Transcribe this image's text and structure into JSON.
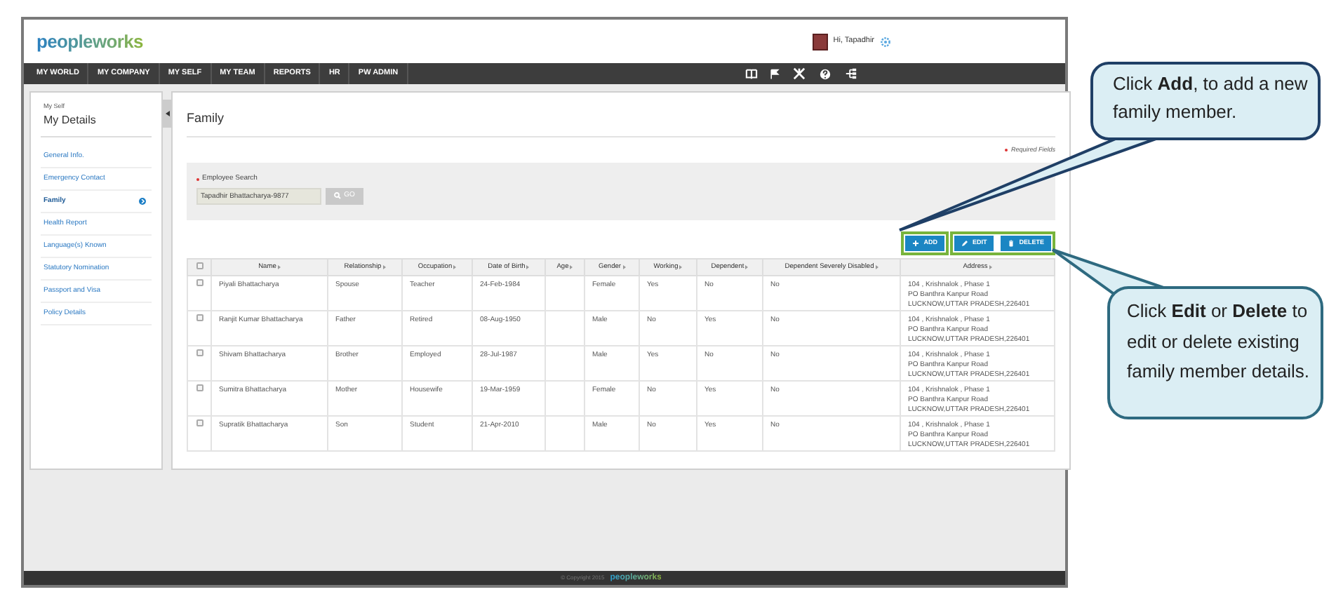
{
  "header": {
    "logo": "peopleworks",
    "greeting": "Hi, Tapadhir"
  },
  "nav": {
    "items": [
      "MY WORLD",
      "MY COMPANY",
      "MY SELF",
      "MY TEAM",
      "REPORTS",
      "HR",
      "PW ADMIN"
    ]
  },
  "sidebar": {
    "section": "My Self",
    "title": "My Details",
    "items": [
      {
        "label": "General Info.",
        "selected": false
      },
      {
        "label": "Emergency Contact",
        "selected": false
      },
      {
        "label": "Family",
        "selected": true
      },
      {
        "label": "Health Report",
        "selected": false
      },
      {
        "label": "Language(s) Known",
        "selected": false
      },
      {
        "label": "Statutory Nomination",
        "selected": false
      },
      {
        "label": "Passport and Visa",
        "selected": false
      },
      {
        "label": "Policy Details",
        "selected": false
      }
    ]
  },
  "main": {
    "title": "Family",
    "required_note": "Required Fields",
    "search": {
      "label": "Employee Search",
      "value": "Tapadhir Bhattacharya-9877",
      "button": "GO"
    },
    "actions": [
      {
        "kind": "add",
        "label": "ADD"
      },
      {
        "kind": "edit",
        "label": "EDIT"
      },
      {
        "kind": "delete",
        "label": "DELETE"
      }
    ],
    "table": {
      "header_checked": false,
      "columns": [
        "Name",
        "Relationship",
        "Occupation",
        "Date of Birth",
        "Age",
        "Gender",
        "Working",
        "Dependent",
        "Dependent Severely Disabled",
        "Address"
      ],
      "rows": [
        {
          "checked": false,
          "cells": [
            "Piyali Bhattacharya",
            "Spouse",
            "Teacher",
            "24-Feb-1984",
            "",
            "Female",
            "Yes",
            "No",
            "No",
            "104 , Krishnalok , Phase 1\nPO Banthra Kanpur Road\nLUCKNOW,UTTAR PRADESH,226401"
          ]
        },
        {
          "checked": false,
          "cells": [
            "Ranjit Kumar Bhattacharya",
            "Father",
            "Retired",
            "08-Aug-1950",
            "",
            "Male",
            "No",
            "Yes",
            "No",
            "104 , Krishnalok , Phase 1\nPO Banthra Kanpur Road\nLUCKNOW,UTTAR PRADESH,226401"
          ]
        },
        {
          "checked": false,
          "cells": [
            "Shivam Bhattacharya",
            "Brother",
            "Employed",
            "28-Jul-1987",
            "",
            "Male",
            "Yes",
            "No",
            "No",
            "104 , Krishnalok , Phase 1\nPO Banthra Kanpur Road\nLUCKNOW,UTTAR PRADESH,226401"
          ]
        },
        {
          "checked": false,
          "cells": [
            "Sumitra Bhattacharya",
            "Mother",
            "Housewife",
            "19-Mar-1959",
            "",
            "Female",
            "No",
            "Yes",
            "No",
            "104 , Krishnalok , Phase 1\nPO Banthra Kanpur Road\nLUCKNOW,UTTAR PRADESH,226401"
          ]
        },
        {
          "checked": false,
          "cells": [
            "Supratik Bhattacharya",
            "Son",
            "Student",
            "21-Apr-2010",
            "",
            "Male",
            "No",
            "Yes",
            "No",
            "104 , Krishnalok , Phase 1\nPO Banthra Kanpur Road\nLUCKNOW,UTTAR PRADESH,226401"
          ]
        }
      ]
    }
  },
  "footer": {
    "copyright": "© Copyright 2015",
    "logo": "peopleworks"
  },
  "callouts": [
    {
      "text": "Click **Add**, to add a new family member."
    },
    {
      "text": "Click **Edit** or **Delete** to edit or delete existing family member details."
    }
  ]
}
